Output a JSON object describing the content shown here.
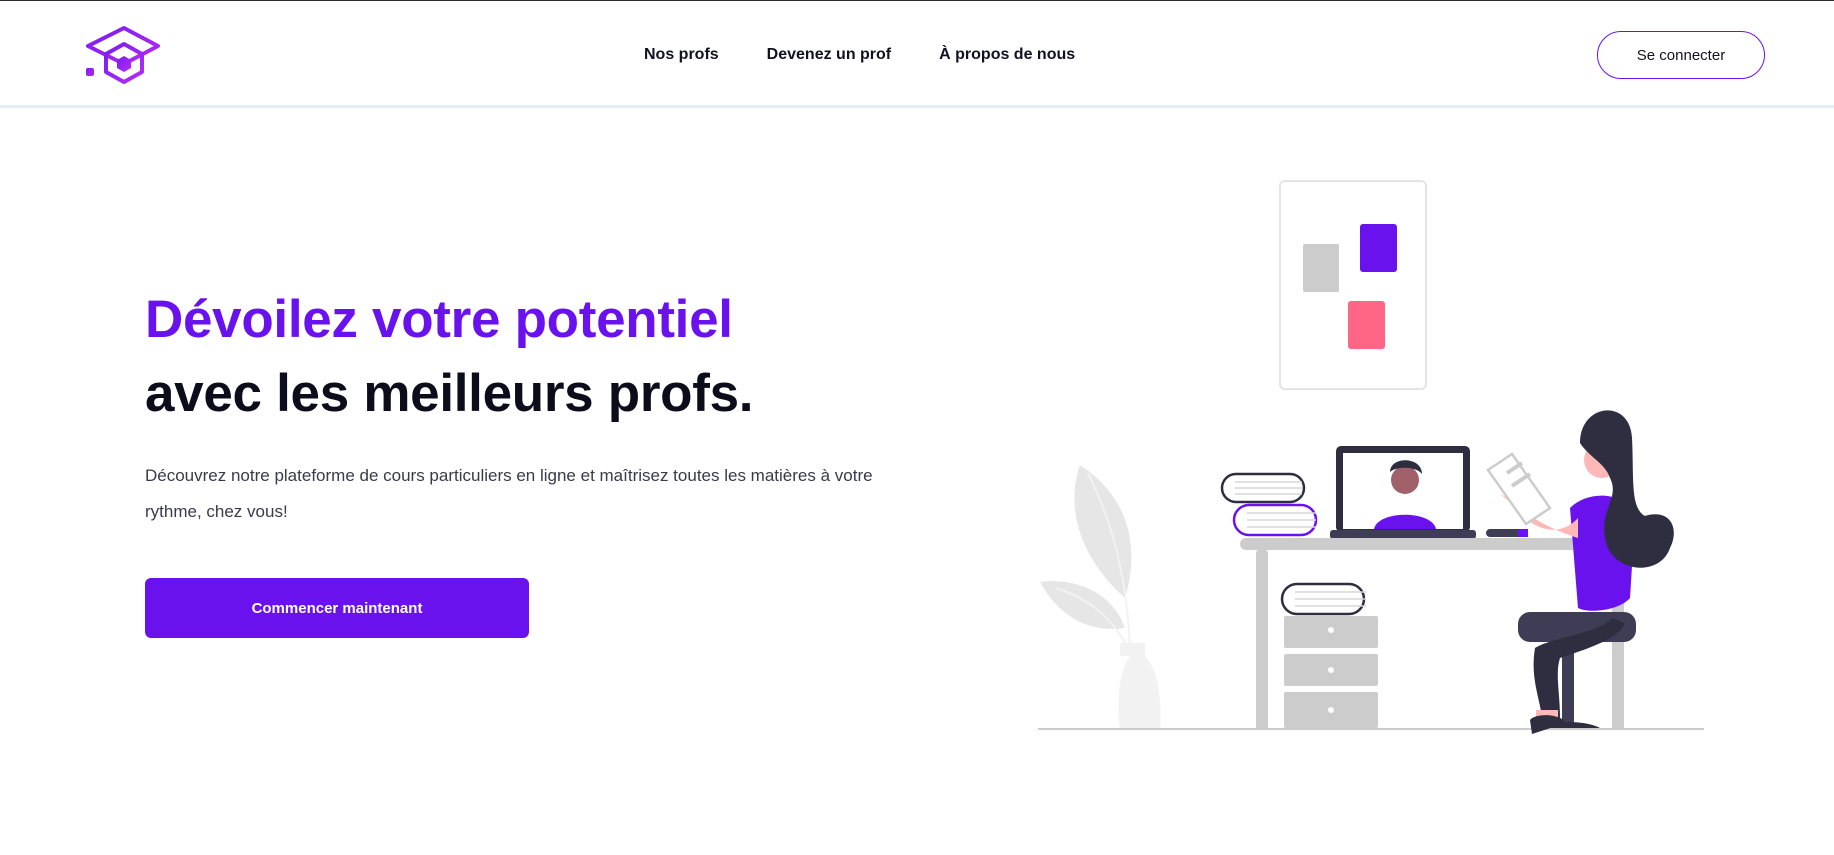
{
  "brand": {
    "logo_icon": "graduation-cap-hexagon-logo",
    "accent_color": "#6a12ee"
  },
  "nav": {
    "items": [
      {
        "label": "Nos profs"
      },
      {
        "label": "Devenez un prof"
      },
      {
        "label": "À propos de nous"
      }
    ]
  },
  "header": {
    "login_label": "Se connecter"
  },
  "hero": {
    "title_line1": "Dévoilez votre potentiel",
    "title_line2": "avec les meilleurs profs.",
    "description": "Découvrez notre plateforme de cours particuliers en ligne et maîtrisez toutes les matières à votre rythme, chez vous!",
    "cta_label": "Commencer maintenant"
  },
  "illustration": {
    "icon": "online-class-illustration",
    "colors": {
      "purple": "#6a12ee",
      "pink": "#ff6584",
      "dark": "#2f2e41",
      "grey": "#cccccc"
    }
  }
}
